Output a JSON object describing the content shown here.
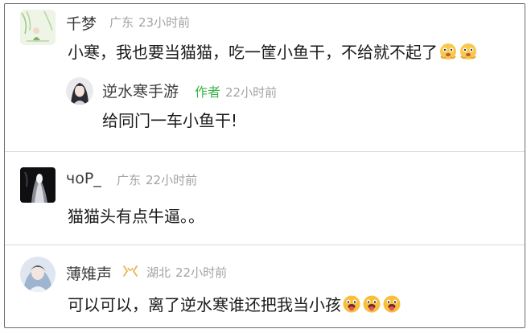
{
  "comments": [
    {
      "name": "千梦",
      "location": "广东",
      "time": "23小时前",
      "text": "小寒，我也要当猫猫，吃一筐小鱼干，不给就不起了",
      "emojis": [
        "sticker-emoji",
        "sticker-emoji"
      ],
      "reply": {
        "name": "逆水寒手游",
        "badge": "作者",
        "time": "22小时前",
        "text": "给同门一车小鱼干!"
      }
    },
    {
      "name": "ч​oP_",
      "location": "广东",
      "time": "22小时前",
      "text": "猫猫头有点牛逼。。"
    },
    {
      "name": "薄雉声",
      "location": "湖北",
      "time": "22小时前",
      "text": "可以可以，离了逆水寒谁还把我当小孩",
      "emojis": [
        "tongue-emoji",
        "tongue-emoji",
        "tongue-emoji"
      ]
    }
  ],
  "colors": {
    "author_badge": "#3fb24a",
    "meta_text": "#a3a3a3",
    "badge_icon": "#e9b64a"
  }
}
